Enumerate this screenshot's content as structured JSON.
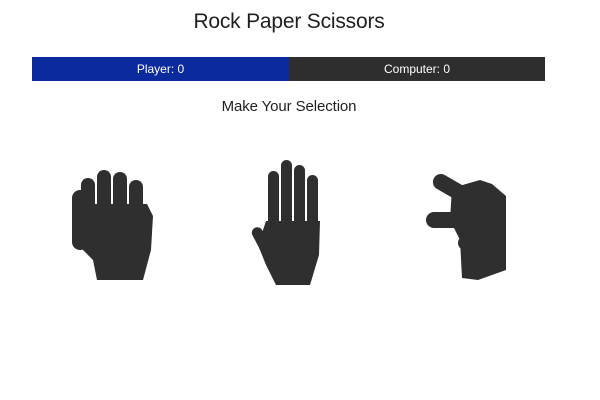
{
  "game": {
    "title": "Rock Paper Scissors",
    "prompt": "Make Your Selection"
  },
  "scoreboard": {
    "player_label": "Player: 0",
    "computer_label": "Computer: 0",
    "player_score": 0,
    "computer_score": 0,
    "player_color": "#0a2a9e",
    "computer_color": "#2e2e2e"
  },
  "choices": [
    {
      "id": "rock",
      "icon": "fist-icon"
    },
    {
      "id": "paper",
      "icon": "open-hand-icon"
    },
    {
      "id": "scissors",
      "icon": "scissors-hand-icon"
    }
  ],
  "colors": {
    "icon": "#2f2f2f"
  }
}
